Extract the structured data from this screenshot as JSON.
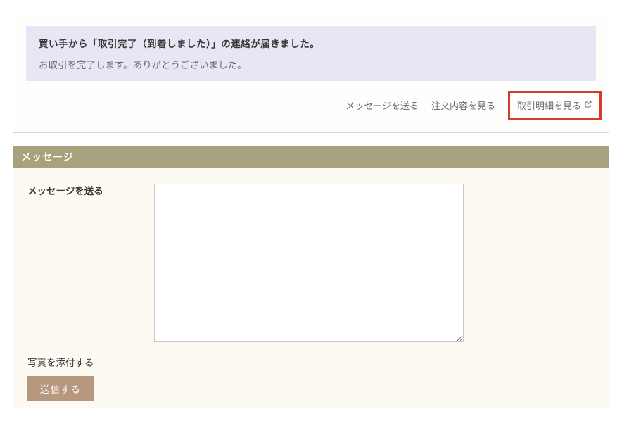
{
  "notice": {
    "title": "買い手から「取引完了（到着しました）」の連絡が届きました。",
    "body": "お取引を完了します。ありがとうございました。"
  },
  "links": {
    "send_message": "メッセージを送る",
    "view_order": "注文内容を見る",
    "view_detail": "取引明細を見る"
  },
  "section": {
    "title": "メッセージ"
  },
  "form": {
    "label": "メッセージを送る",
    "value": "",
    "attach": "写真を添付する",
    "send": "送信する"
  }
}
